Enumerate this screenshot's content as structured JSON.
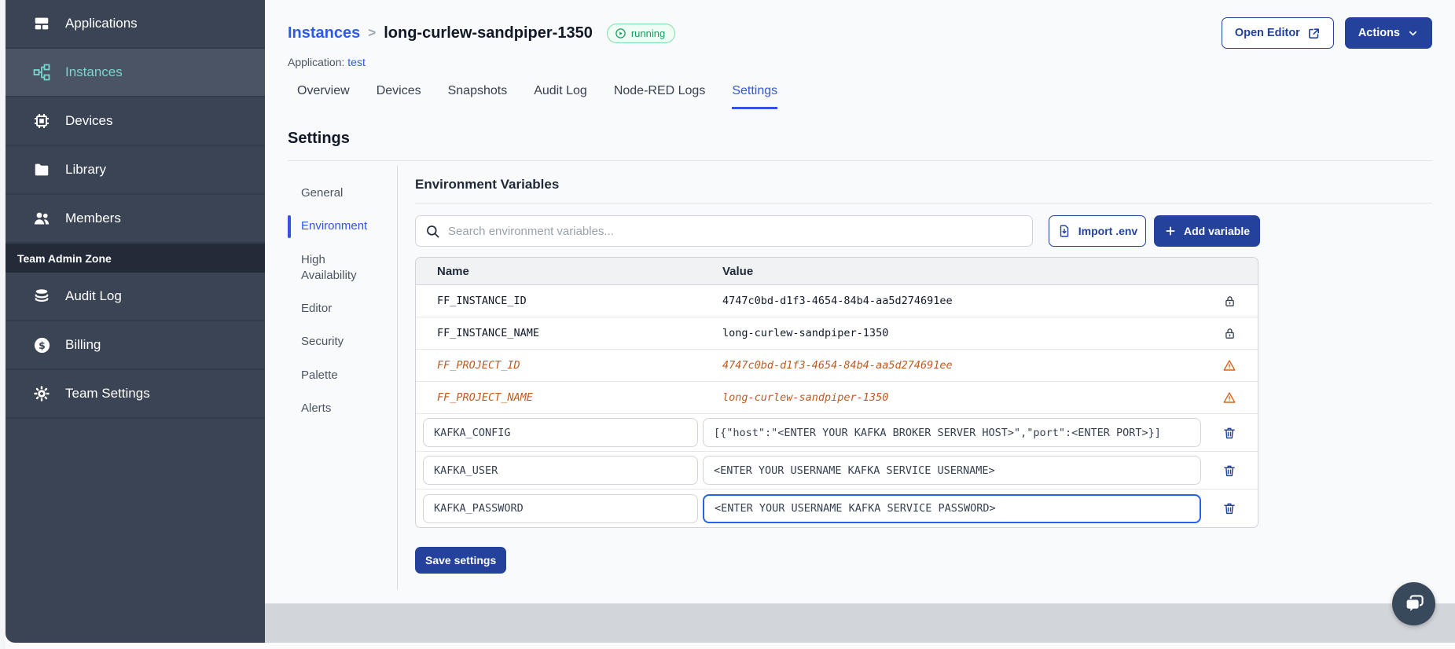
{
  "colors": {
    "accent_navy": "#24419b",
    "link_blue": "#2b5ce6",
    "active_blue": "#3353e0",
    "sidebar_bg": "#3b4454",
    "sidebar_active_teal": "#7bd4cf",
    "status_green": "#169d5f",
    "deprecated_orange": "#bf5b20",
    "focus_blue": "#2563eb"
  },
  "sidebar": {
    "items": [
      {
        "label": "Applications",
        "icon": "applications-icon"
      },
      {
        "label": "Instances",
        "icon": "instances-icon"
      },
      {
        "label": "Devices",
        "icon": "devices-icon"
      },
      {
        "label": "Library",
        "icon": "library-icon"
      },
      {
        "label": "Members",
        "icon": "members-icon"
      }
    ],
    "admin_section_label": "Team Admin Zone",
    "admin_items": [
      {
        "label": "Audit Log",
        "icon": "audit-log-icon"
      },
      {
        "label": "Billing",
        "icon": "billing-icon"
      },
      {
        "label": "Team Settings",
        "icon": "team-settings-icon"
      }
    ]
  },
  "header": {
    "breadcrumb_parent": "Instances",
    "breadcrumb_separator": ">",
    "instance_name": "long-curlew-sandpiper-1350",
    "status_badge": "running",
    "application_label": "Application:",
    "application_name": "test",
    "open_editor_label": "Open Editor",
    "actions_label": "Actions"
  },
  "tabs": {
    "items": [
      "Overview",
      "Devices",
      "Snapshots",
      "Audit Log",
      "Node-RED Logs",
      "Settings"
    ],
    "active": "Settings"
  },
  "settings": {
    "title": "Settings",
    "nav": [
      "General",
      "Environment",
      "High Availability",
      "Editor",
      "Security",
      "Palette",
      "Alerts"
    ],
    "active_nav": "Environment"
  },
  "env": {
    "title": "Environment Variables",
    "search_placeholder": "Search environment variables...",
    "import_label": "Import .env",
    "add_label": "Add variable",
    "columns": {
      "name": "Name",
      "value": "Value"
    },
    "rows": [
      {
        "name": "FF_INSTANCE_ID",
        "value": "4747c0bd-d1f3-4654-84b4-aa5d274691ee",
        "state": "locked"
      },
      {
        "name": "FF_INSTANCE_NAME",
        "value": "long-curlew-sandpiper-1350",
        "state": "locked"
      },
      {
        "name": "FF_PROJECT_ID",
        "value": "4747c0bd-d1f3-4654-84b4-aa5d274691ee",
        "state": "deprecated"
      },
      {
        "name": "FF_PROJECT_NAME",
        "value": "long-curlew-sandpiper-1350",
        "state": "deprecated"
      },
      {
        "name": "KAFKA_CONFIG",
        "value": "[{\"host\":\"<ENTER YOUR KAFKA BROKER SERVER HOST>\",\"port\":<ENTER PORT>}]",
        "state": "editable"
      },
      {
        "name": "KAFKA_USER",
        "value": "<ENTER YOUR USERNAME KAFKA SERVICE USERNAME>",
        "state": "editable"
      },
      {
        "name": "KAFKA_PASSWORD",
        "value": "<ENTER YOUR USERNAME KAFKA SERVICE PASSWORD>",
        "state": "editable",
        "focused": true
      }
    ],
    "save_label": "Save settings"
  }
}
